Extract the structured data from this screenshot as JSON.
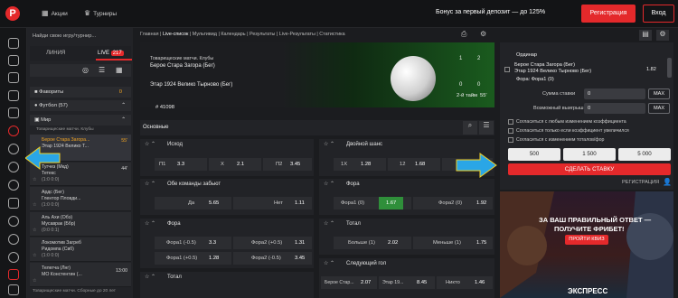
{
  "topbar": {
    "logo": "P",
    "nav": [
      {
        "icon": "promo-icon",
        "label": "Акции"
      },
      {
        "icon": "trophy-icon",
        "label": "Турниры"
      }
    ],
    "bonus": "Бонус за первый депозит — до 125%",
    "register": "Регистрация",
    "login": "Вход"
  },
  "sidebar": {
    "search_placeholder": "Найди свою игру/турнир...",
    "tabs": [
      {
        "label": "ЛИНИЯ"
      },
      {
        "label": "LIVE",
        "badge": "217"
      }
    ],
    "favorites": "Фавориты",
    "favorites_count": "0",
    "football": "Футбол (57)",
    "world": "Мир",
    "league": "Товарищеские матчи. Клубы",
    "matches": [
      {
        "home": "Берое Стара Загора...",
        "away": "Этар 1924 Велико Т...",
        "score": "0 0",
        "time": "55'",
        "active": true
      },
      {
        "home": "Тугчез (Мкд)",
        "away": "Тетекс",
        "score": "(1:0 0:0)",
        "time": "44'",
        "active": false
      },
      {
        "home": "Ардс (Бег)",
        "away": "Глентор Пловди...",
        "score": "(1:0 0:0)",
        "time": "",
        "active": false
      },
      {
        "home": "Аль Ахи (Обэ)",
        "away": "Мусаврак (Ббр)",
        "score": "(0:0 0:1)",
        "time": "",
        "active": false
      },
      {
        "home": "Локомотив Загреб",
        "away": "Ридомпа (Свб)",
        "score": "(1:0 0:0)",
        "time": "",
        "active": false
      },
      {
        "home": "Телегча (Лнг)",
        "away": "МО Констентин (...",
        "score": "",
        "time": "13:00",
        "active": false
      }
    ],
    "footer": "Товарищеские матчи. Сборные до 20 лет"
  },
  "breadcrumb": [
    "Главная",
    "Live-список",
    "Мультивид",
    "Календарь",
    "Результаты",
    "Live-Результаты",
    "Статистика"
  ],
  "hero": {
    "league": "Товарищеские матчи. Клубы",
    "home": "Берое Стара Загора (Бег)",
    "away": "Этар 1924 Велико Тырново (Бег)",
    "score_home": [
      "1",
      "2"
    ],
    "score_away": [
      "0",
      "0"
    ],
    "period": "2-й тайм",
    "minute": "55'",
    "match_id": "# 41098"
  },
  "tabs": {
    "main": "Основные"
  },
  "markets": [
    {
      "title": "Исход",
      "rows": [
        [
          {
            "l": "П1",
            "v": "3.3"
          },
          {
            "l": "X",
            "v": "2.1"
          },
          {
            "l": "П2",
            "v": "3.45"
          }
        ]
      ]
    },
    {
      "title": "Двойной шанс",
      "rows": [
        [
          {
            "l": "1X",
            "v": "1.28"
          },
          {
            "l": "12",
            "v": "1.68"
          },
          {
            "l": "",
            "v": ""
          }
        ]
      ]
    },
    {
      "title": "Обе команды забьют",
      "rows": [
        [
          {
            "l": "Да",
            "v": "5.65"
          },
          {
            "l": "Нет",
            "v": "1.11"
          }
        ]
      ]
    },
    {
      "title": "Фора",
      "rows": [
        [
          {
            "l": "Фора1 (0)",
            "v": "1.67"
          },
          {
            "l": "Фора2 (0)",
            "v": "1.92"
          }
        ]
      ]
    },
    {
      "title": "Фора",
      "rows": [
        [
          {
            "l": "Фора1 (-0.5)",
            "v": "3.3"
          },
          {
            "l": "Фора2 (+0.5)",
            "v": "1.31"
          }
        ],
        [
          {
            "l": "Фора1 (+0.5)",
            "v": "1.28"
          },
          {
            "l": "Фора2 (-0.5)",
            "v": "3.45"
          }
        ]
      ]
    },
    {
      "title": "Тотал",
      "rows": [
        [
          {
            "l": "Больше (1)",
            "v": "2.02"
          },
          {
            "l": "Меньше (1)",
            "v": "1.75"
          }
        ]
      ]
    },
    {
      "title": "Тотал",
      "rows": []
    },
    {
      "title": "Следующий гол",
      "rows": [
        [
          {
            "l": "Берое Стар...",
            "v": "2.07"
          },
          {
            "l": "Этар 19...",
            "v": "8.45"
          },
          {
            "l": "Никто",
            "v": "1.46"
          }
        ]
      ]
    }
  ],
  "coupon": {
    "type": "Ординар",
    "event": "Берое Стара Загора (Бег)",
    "event2": "Этар 1924 Велико Тырново (Бег)",
    "odd": "1.82",
    "selection": "Фора: Фора1 (0)",
    "stake_label": "Сумма ставки",
    "stake_value": "0",
    "win_label": "Возможный выигрыш",
    "win_value": "0",
    "max": "MAX",
    "checks": [
      "Согласиться с любым изменением коэффициента",
      "Согласиться только если коэффициент увеличился",
      "Согласиться с изменением тоталов/фор"
    ],
    "quick": [
      "500",
      "1 500",
      "5 000"
    ],
    "submit": "СДЕЛАТЬ СТАВКУ",
    "register": "РЕГИСТРАЦИЯ"
  },
  "promo": {
    "headline": "ЗА ВАШ ПРАВИЛЬНЫЙ ОТВЕТ —",
    "subheadline": "ПОЛУЧИТЕ ФРИБЕТ!",
    "button": "ПРОЙТИ КВИЗ",
    "bottom": "ЭКСПРЕСС"
  },
  "colors": {
    "accent": "#e4292b",
    "odds": "#f5a623",
    "arrow": "#2aa6e6"
  }
}
